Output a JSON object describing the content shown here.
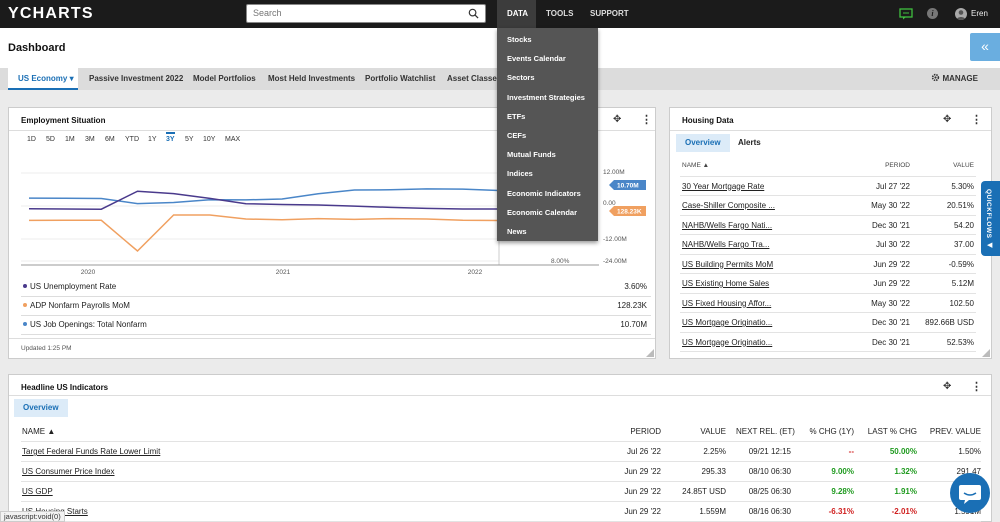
{
  "topbar": {
    "logo": "YCHARTS",
    "search_placeholder": "Search",
    "nav": [
      "DATA",
      "TOOLS",
      "SUPPORT"
    ],
    "username": "Eren",
    "info_glyph": "i"
  },
  "page": {
    "title": "Dashboard",
    "collapse_glyph": "«"
  },
  "tabs": {
    "items": [
      "US Economy",
      "Passive Investment 2022",
      "Model Portfolios",
      "Most Held Investments",
      "Portfolio Watchlist",
      "Asset Classes"
    ],
    "manage": "MANAGE"
  },
  "data_menu": [
    "Stocks",
    "Events Calendar",
    "Sectors",
    "Investment Strategies",
    "ETFs",
    "CEFs",
    "Mutual Funds",
    "Indices",
    "Economic Indicators",
    "Economic Calendar",
    "News"
  ],
  "employment": {
    "title": "Employment Situation",
    "time_ranges": [
      "1D",
      "5D",
      "1M",
      "3M",
      "6M",
      "YTD",
      "1Y",
      "3Y",
      "5Y",
      "10Y",
      "MAX"
    ],
    "active_range": "3Y",
    "updated": "Updated 1:25 PM",
    "series": [
      {
        "name": "US Unemployment Rate",
        "value": "3.60%",
        "color": "#4a3a8c"
      },
      {
        "name": "ADP Nonfarm Payrolls MoM",
        "value": "128.23K",
        "color": "#f0a060"
      },
      {
        "name": "US Job Openings: Total Nonfarm",
        "value": "10.70M",
        "color": "#4a86c8"
      }
    ]
  },
  "chart_data": {
    "type": "line",
    "x": [
      "2019-08",
      "2019-11",
      "2020-02",
      "2020-04",
      "2020-05",
      "2020-07",
      "2020-10",
      "2021-01",
      "2021-04",
      "2021-07",
      "2021-10",
      "2022-01",
      "2022-04",
      "2022-07"
    ],
    "x_tick_labels": [
      "2020",
      "2021",
      "2022"
    ],
    "series": [
      {
        "name": "US Job Openings: Total Nonfarm",
        "axis": "left",
        "values": [
          7.4,
          7.3,
          7.2,
          5.0,
          5.5,
          6.7,
          6.6,
          7.0,
          9.3,
          10.9,
          11.0,
          11.4,
          11.3,
          10.7
        ]
      },
      {
        "name": "US Unemployment Rate",
        "axis": "right",
        "values": [
          3.7,
          3.6,
          3.5,
          14.7,
          13.2,
          10.2,
          6.9,
          6.4,
          6.1,
          5.4,
          4.6,
          4.0,
          3.6,
          3.6
        ]
      },
      {
        "name": "ADP Nonfarm Payrolls MoM",
        "axis": "left",
        "values": [
          150,
          200,
          180,
          -19000,
          2300,
          1500,
          500,
          300,
          600,
          400,
          600,
          500,
          200,
          128.23
        ]
      }
    ],
    "right_axis_labels": [
      "12.00M",
      "0.00",
      "-12.00M",
      "-24.00M"
    ],
    "left_axis_labels": [
      "8.00%"
    ],
    "end_labels": [
      "10.70M",
      "128.23K"
    ]
  },
  "housing": {
    "title": "Housing Data",
    "subtabs": [
      "Overview",
      "Alerts"
    ],
    "headers": {
      "name": "NAME",
      "period": "PERIOD",
      "value": "VALUE",
      "sort_glyph": "▲"
    },
    "rows": [
      {
        "name": "30 Year Mortgage Rate",
        "period": "Jul 27 '22",
        "value": "5.30%"
      },
      {
        "name": "Case-Shiller Composite ...",
        "period": "May 30 '22",
        "value": "20.51%"
      },
      {
        "name": "NAHB/Wells Fargo Nati...",
        "period": "Dec 30 '21",
        "value": "54.20"
      },
      {
        "name": "NAHB/Wells Fargo Tra...",
        "period": "Jul 30 '22",
        "value": "37.00"
      },
      {
        "name": "US Building Permits MoM",
        "period": "Jun 29 '22",
        "value": "-0.59%"
      },
      {
        "name": "US Existing Home Sales",
        "period": "Jun 29 '22",
        "value": "5.12M"
      },
      {
        "name": "US Fixed Housing Affor...",
        "period": "May 30 '22",
        "value": "102.50"
      },
      {
        "name": "US Mortgage Originatio...",
        "period": "Dec 30 '21",
        "value": "892.66B USD"
      },
      {
        "name": "US Mortgage Originatio...",
        "period": "Dec 30 '21",
        "value": "52.53%"
      }
    ]
  },
  "headline": {
    "title": "Headline US Indicators",
    "subtab": "Overview",
    "headers": [
      "NAME",
      "PERIOD",
      "VALUE",
      "NEXT REL. (ET)",
      "% CHG (1Y)",
      "LAST % CHG",
      "PREV. VALUE"
    ],
    "sort_glyph": "▲",
    "rows": [
      {
        "name": "Target Federal Funds Rate Lower Limit",
        "period": "Jul 26 '22",
        "value": "2.25%",
        "next": "09/21 12:15",
        "chg1y": "--",
        "last": "50.00%",
        "prev": "1.50%"
      },
      {
        "name": "US Consumer Price Index",
        "period": "Jun 29 '22",
        "value": "295.33",
        "next": "08/10 06:30",
        "chg1y": "9.00%",
        "last": "1.32%",
        "prev": "291.47"
      },
      {
        "name": "US GDP",
        "period": "Jun 29 '22",
        "value": "24.85T USD",
        "next": "08/25 06:30",
        "chg1y": "9.28%",
        "last": "1.91%",
        "prev": "24.39"
      },
      {
        "name": "US Housing Starts",
        "period": "Jun 29 '22",
        "value": "1.559M",
        "next": "08/16 06:30",
        "chg1y": "-6.31%",
        "last": "-2.01%",
        "prev": "1.591M"
      }
    ]
  },
  "quickflows": {
    "label": "QUICKFLOWS",
    "arrow": "◀"
  },
  "status_bar": "javascript:void(0)"
}
